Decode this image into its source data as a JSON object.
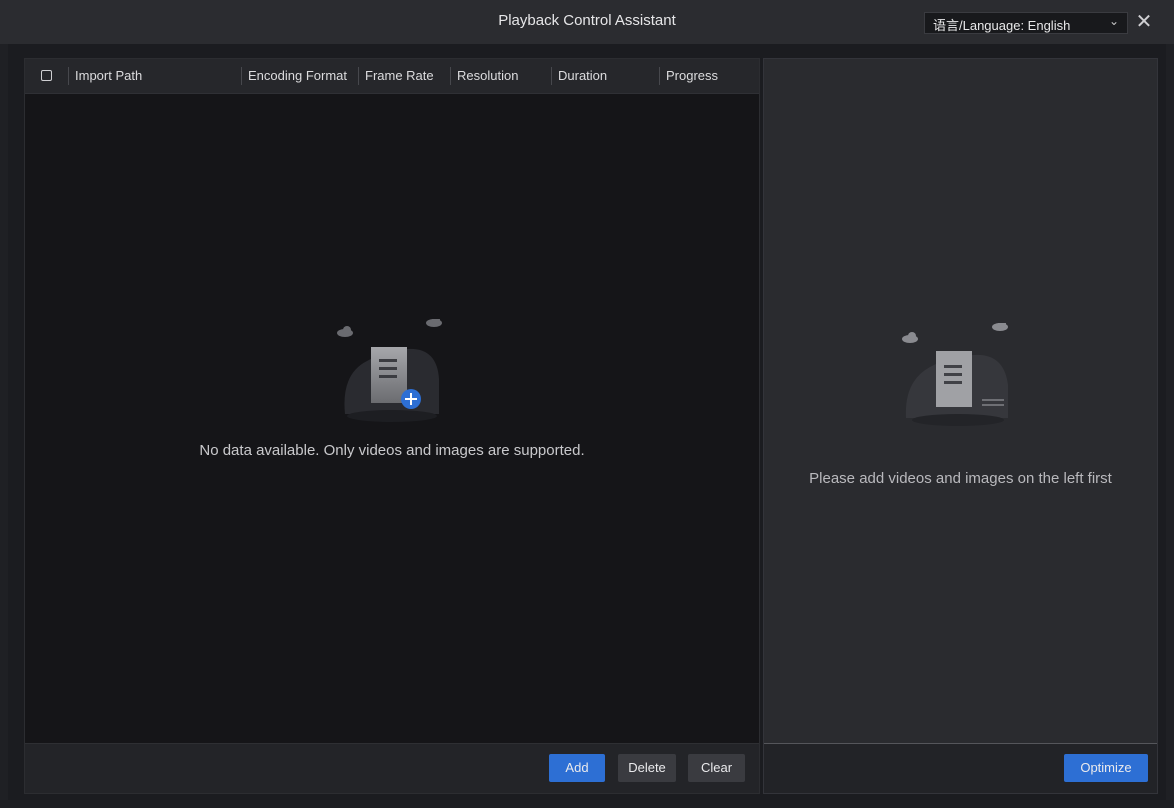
{
  "window": {
    "title": "Playback Control Assistant",
    "language_label": "语言/Language: English",
    "chevron_glyph": "⌄",
    "close_glyph": "✕"
  },
  "table": {
    "columns": [
      "Import Path",
      "Encoding Format",
      "Frame Rate",
      "Resolution",
      "Duration",
      "Progress"
    ]
  },
  "left_panel": {
    "empty_message": "No data available. Only videos and images are supported."
  },
  "left_actions": {
    "add_label": "Add",
    "delete_label": "Delete",
    "clear_label": "Clear"
  },
  "right_panel": {
    "empty_message": "Please add videos and images on the left first",
    "optimize_label": "Optimize"
  },
  "colors": {
    "accent": "#2d6fd4",
    "background": "#1f2024"
  }
}
